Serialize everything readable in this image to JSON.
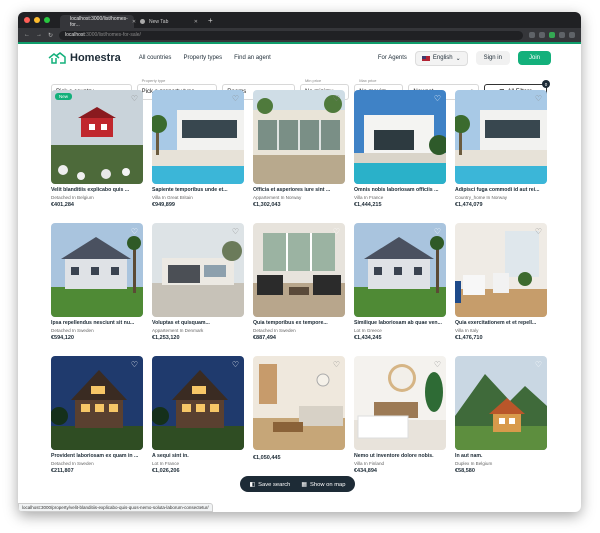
{
  "browser": {
    "tabs": [
      {
        "label": "localhost:3000/list/homes-for..."
      },
      {
        "label": "New Tab"
      }
    ],
    "url_host": "localhost",
    "url_path": ":3000/list/homes-for-sale/",
    "status_url": "localhost:3000/property/velit-blanditiis-explicabo-quis-quos-nemo-soluta-laborum-consectetur/"
  },
  "header": {
    "brand": "Homestra",
    "nav": [
      "All countries",
      "Property types",
      "Find an agent"
    ],
    "for_agents": "For Agents",
    "language": "English",
    "signin": "Sign in",
    "join": "Join"
  },
  "filters": {
    "country": {
      "value": "Pick a country"
    },
    "property_type": {
      "caption": "Property type",
      "value": "Pick a property type"
    },
    "rooms": {
      "value": "Rooms"
    },
    "min_price": {
      "caption": "Min price",
      "value": "No minimu..."
    },
    "max_price": {
      "caption": "Max price",
      "value": "No maxim..."
    },
    "sort": {
      "value": "Newest"
    },
    "all_filters": {
      "label": "All Filters",
      "count": "0"
    }
  },
  "listings": [
    {
      "title": "Velit blanditiis explicabo quis ...",
      "sub": "Detached In Belgium",
      "price": "€401,284",
      "badge": "New",
      "scene": "redhouse"
    },
    {
      "title": "Sapiente temporibus unde et...",
      "sub": "Villa In Great Britain",
      "price": "€949,899",
      "badge": "",
      "scene": "poolvilla"
    },
    {
      "title": "Officia et asperiores iure sint ...",
      "sub": "Appartement In Norway",
      "price": "€1,302,043",
      "badge": "",
      "scene": "glasshouse"
    },
    {
      "title": "Omnis nobis laboriosam officiis ...",
      "sub": "Villa In France",
      "price": "€1,444,215",
      "badge": "",
      "scene": "modernpool"
    },
    {
      "title": "Adipisci fuga commodi id aut rei...",
      "sub": "Country_home In Norway",
      "price": "€1,474,079",
      "badge": "",
      "scene": "poolvilla"
    },
    {
      "title": "Ipsa repellendus nesciunt sit nu...",
      "sub": "Detached In Sweden",
      "price": "€594,120",
      "badge": "",
      "scene": "bluehouse"
    },
    {
      "title": "Voluptas et quisquam...",
      "sub": "Appartement In Denmark",
      "price": "€1,253,120",
      "badge": "",
      "scene": "garage"
    },
    {
      "title": "Quia temporibus ex tempore...",
      "sub": "Detached In Sweden",
      "price": "€887,494",
      "badge": "",
      "scene": "livingroom"
    },
    {
      "title": "Similique laboriosam ab quae ven...",
      "sub": "Lot In Greece",
      "price": "€1,434,245",
      "badge": "",
      "scene": "bluehouse"
    },
    {
      "title": "Quia exercitationem et et repell...",
      "sub": "Villa In Italy",
      "price": "€1,476,710",
      "badge": "",
      "scene": "whiteroom"
    },
    {
      "title": "Provident laboriosam ex quam in ...",
      "sub": "Detached In Sweden",
      "price": "€211,807",
      "badge": "",
      "scene": "nighthouse"
    },
    {
      "title": "A sequi sint in.",
      "sub": "Lot In France",
      "price": "€1,026,206",
      "badge": "",
      "scene": "nighthouse"
    },
    {
      "title": "",
      "sub": "",
      "price": "€1,050,445",
      "badge": "",
      "scene": "lounge"
    },
    {
      "title": "Nemo ut inventore dolore nobis.",
      "sub": "Villa In Finland",
      "price": "€434,894",
      "badge": "",
      "scene": "bedroom"
    },
    {
      "title": "In aut nam.",
      "sub": "Duplex In Belgium",
      "price": "€58,580",
      "badge": "",
      "scene": "mountain"
    }
  ],
  "floatbar": {
    "save": "Save search",
    "map": "Show on map"
  },
  "colors": {
    "brand": "#13b07b",
    "dark": "#1d2b36"
  }
}
